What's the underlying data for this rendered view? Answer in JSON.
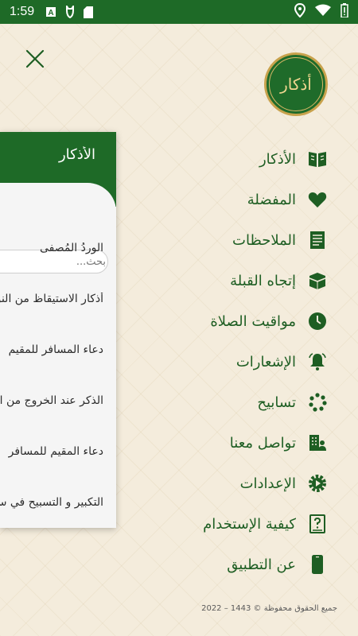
{
  "status_bar": {
    "time": "1:59",
    "icons": [
      "a-box-icon",
      "cat-icon",
      "sd-card-icon",
      "location-icon",
      "wifi-icon",
      "battery-icon"
    ]
  },
  "logo": {
    "text": "أذكار"
  },
  "card": {
    "title": "الأذكار",
    "search": {
      "placeholder": "بحث..."
    },
    "items": [
      "الوردُ المُصفى",
      "أذكار الاستيقاظ من النوم",
      "دعاء المسافر للمقيم",
      "الذكر عند الخروج من المنزل",
      "دعاء المقيم للمسافر",
      "التكبير و التسبيح في سير السفر"
    ]
  },
  "menu": {
    "items": [
      {
        "label": "الأذكار",
        "icon": "book-icon"
      },
      {
        "label": "المفضلة",
        "icon": "heart-icon"
      },
      {
        "label": "الملاحظات",
        "icon": "notes-icon"
      },
      {
        "label": "إتجاه القبلة",
        "icon": "kaaba-icon"
      },
      {
        "label": "مواقيت الصلاة",
        "icon": "clock-icon"
      },
      {
        "label": "الإشعارات",
        "icon": "bell-icon"
      },
      {
        "label": "تسابيح",
        "icon": "beads-icon"
      },
      {
        "label": "تواصل معنا",
        "icon": "contact-icon"
      },
      {
        "label": "الإعدادات",
        "icon": "settings-icon"
      },
      {
        "label": "كيفية الإستخدام",
        "icon": "help-icon"
      },
      {
        "label": "عن التطبيق",
        "icon": "phone-icon"
      }
    ]
  },
  "footer": "جميع الحقوق محفوظة © 1443 – 2022",
  "colors": {
    "primary": "#1e6a27",
    "menu_text": "#1e5e23",
    "background": "#f4ecdc",
    "gold": "#c8a24c"
  }
}
